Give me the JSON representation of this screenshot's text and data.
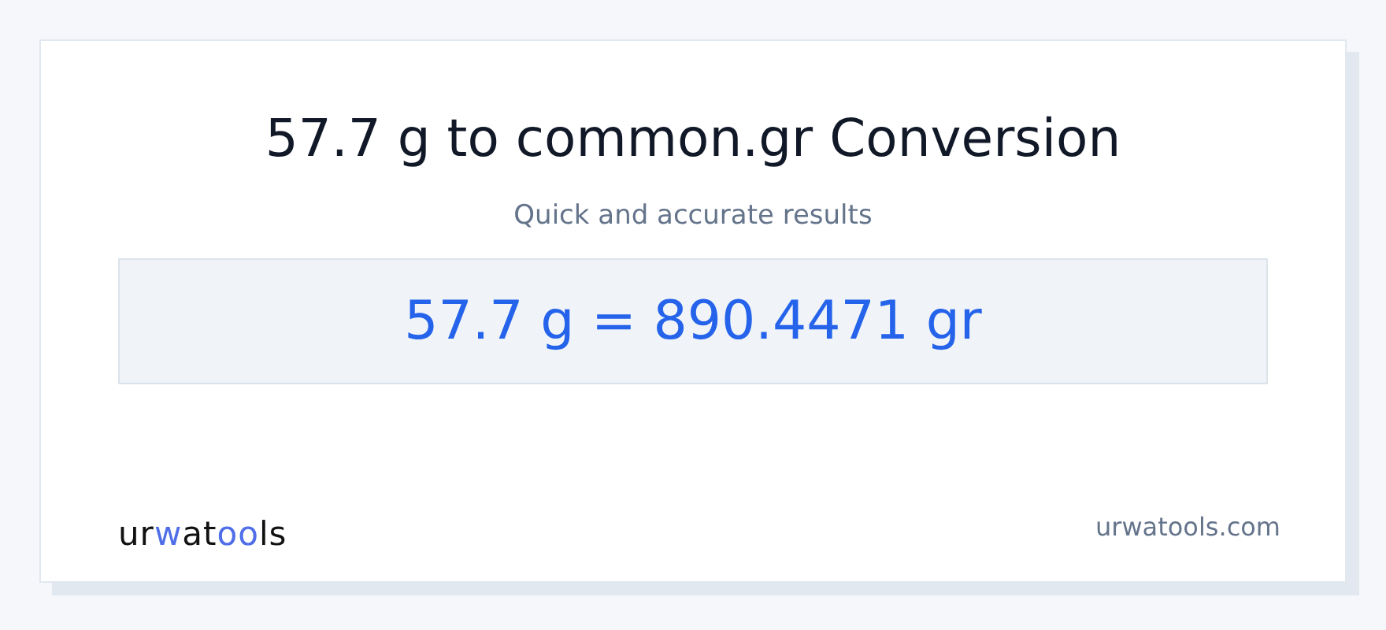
{
  "title": "57.7 g to common.gr Conversion",
  "subtitle": "Quick and accurate results",
  "result": "57.7 g = 890.4471 gr",
  "logo": {
    "parts": [
      {
        "text": "ur",
        "accent": false
      },
      {
        "text": "w",
        "accent": true
      },
      {
        "text": "at",
        "accent": false
      },
      {
        "text": "oo",
        "accent": true
      },
      {
        "text": "ls",
        "accent": false
      }
    ]
  },
  "site": "urwatools.com"
}
